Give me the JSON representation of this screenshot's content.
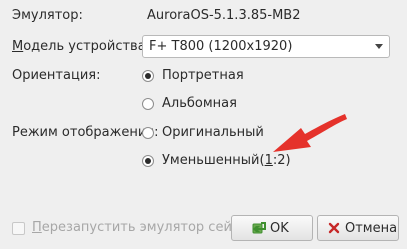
{
  "emulator": {
    "label": "Эмулятор:",
    "value": "AuroraOS-5.1.3.85-MB2"
  },
  "device_model": {
    "label_mnemonic": "М",
    "label_rest": "одель устройства:",
    "selected": "F+ T800 (1200x1920)"
  },
  "orientation": {
    "label": "Ориентация:",
    "options": [
      {
        "label": "Портретная",
        "checked": true
      },
      {
        "label": "Альбомная",
        "checked": false
      }
    ]
  },
  "display_mode": {
    "label": "Режим отображения:",
    "options": [
      {
        "label": "Оригинальный",
        "checked": false
      },
      {
        "label_before": "Уменьшенный(",
        "label_mnemonic": "1",
        "label_after": ":2)",
        "checked": true
      }
    ]
  },
  "restart_checkbox": {
    "label_mnemonic": "П",
    "label_rest": "ерезапустить эмулятор сейчас",
    "checked": false,
    "enabled": false
  },
  "buttons": {
    "ok": {
      "label": "OK",
      "icon": "ok-check-icon"
    },
    "cancel": {
      "label": "Отмена",
      "icon": "cancel-x-icon"
    }
  },
  "annotation": {
    "arrow_color": "#e5322b"
  },
  "colors": {
    "window_background": "#efefef",
    "text": "#2b2b2b",
    "disabled_text": "#a7a7a7",
    "ok_icon_green": "#3f8f2f",
    "cancel_icon_red": "#c62828"
  }
}
